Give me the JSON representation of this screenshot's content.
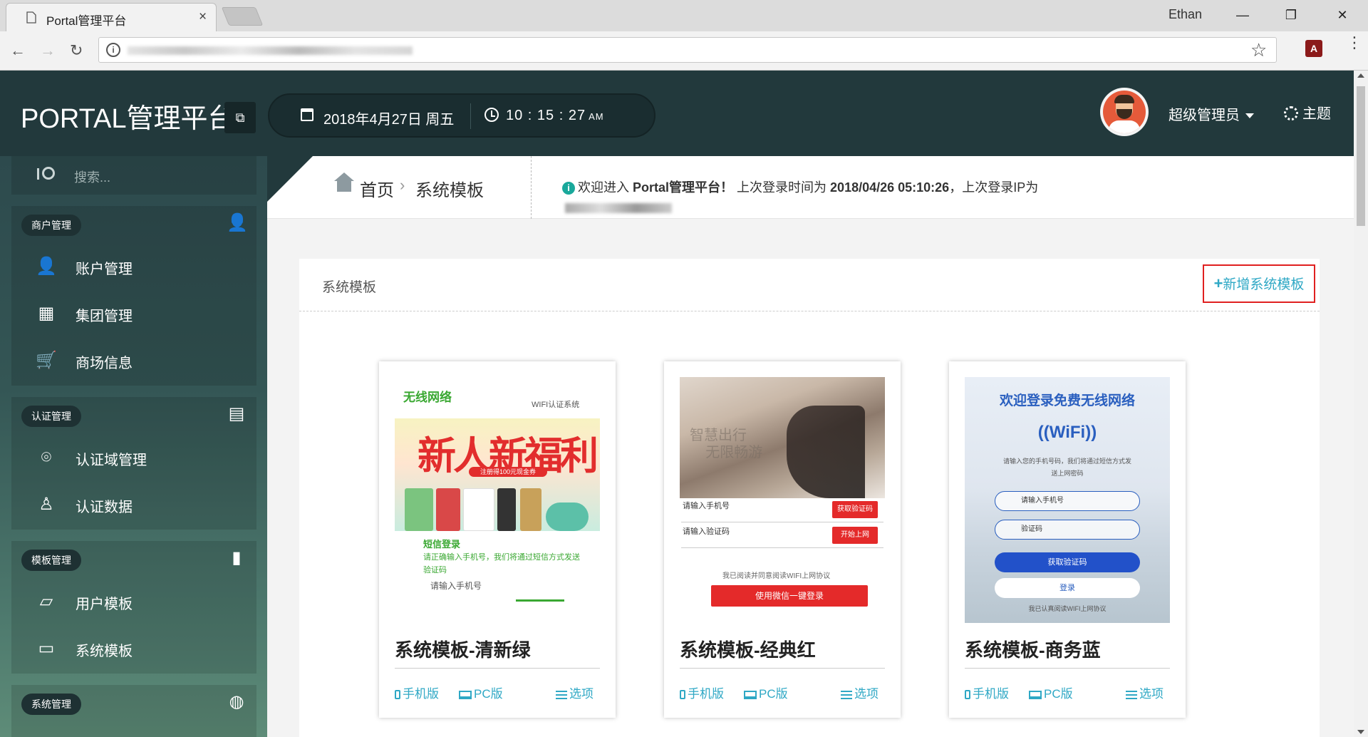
{
  "browser": {
    "tab_title": "Portal管理平台",
    "close_glyph": "×",
    "user": "Ethan",
    "minimize_glyph": "—",
    "restore_glyph": "❐",
    "win_close_glyph": "✕",
    "back_glyph": "←",
    "forward_glyph": "→",
    "reload_glyph": "↻",
    "star_glyph": "☆",
    "info_glyph": "i",
    "pdf_glyph": "A",
    "menu_glyph": "⋮"
  },
  "header": {
    "brand": "PORTAL管理平台",
    "toggle_glyph": "⧉",
    "date": "2018年4月27日 周五",
    "time": "10 : 15 : 27",
    "ampm": "AM",
    "user_name": "超级管理员",
    "theme_label": "主题"
  },
  "sidebar": {
    "search_placeholder": "搜索...",
    "groups": [
      {
        "label": "商户管理",
        "icon": "add-user-icon",
        "icon_glyph": "👤",
        "items": [
          {
            "label": "账户管理",
            "icon": "user-icon",
            "icon_glyph": "👤"
          },
          {
            "label": "集团管理",
            "icon": "building-icon",
            "icon_glyph": "▦"
          },
          {
            "label": "商场信息",
            "icon": "cart-icon",
            "icon_glyph": "🛒"
          }
        ]
      },
      {
        "label": "认证管理",
        "icon": "document-icon",
        "icon_glyph": "▤",
        "items": [
          {
            "label": "认证域管理",
            "icon": "location-icon",
            "icon_glyph": "⌾"
          },
          {
            "label": "认证数据",
            "icon": "person-outline-icon",
            "icon_glyph": "♙"
          }
        ]
      },
      {
        "label": "模板管理",
        "icon": "book-icon",
        "icon_glyph": "▮",
        "items": [
          {
            "label": "用户模板",
            "icon": "cards-icon",
            "icon_glyph": "▱"
          },
          {
            "label": "系统模板",
            "icon": "monitor-icon",
            "icon_glyph": "▭"
          }
        ]
      },
      {
        "label": "系统管理",
        "icon": "globe-icon",
        "icon_glyph": "◍",
        "items": []
      }
    ]
  },
  "breadcrumb": {
    "home": "首页",
    "sep": "›",
    "current": "系统模板"
  },
  "welcome": {
    "icon_glyph": "i",
    "prefix": "欢迎进入 ",
    "platform": "Portal管理平台！",
    "last_login_label": " 上次登录时间为 ",
    "last_login_time": "2018/04/26 05:10:26",
    "last_ip_label": "，上次登录IP为"
  },
  "panel": {
    "title": "系统模板",
    "add_plus": "+",
    "add_label": "新增系统模板"
  },
  "cards": [
    {
      "title": "系统模板-清新绿",
      "links": {
        "mobile": "手机版",
        "pc": "PC版",
        "options": "选项"
      },
      "preview": {
        "logo": "无线网络",
        "wifi_tag": "WIFI认证系统",
        "banner": "新人新福利",
        "strip": "注册得100元现金券",
        "sms_title": "短信登录",
        "sms_desc": "请正确输入手机号，我们将通过短信方式发送验证码",
        "phone_placeholder": "请输入手机号"
      }
    },
    {
      "title": "系统模板-经典红",
      "links": {
        "mobile": "手机版",
        "pc": "PC版",
        "options": "选项"
      },
      "preview": {
        "watermark_1": "智慧出行",
        "watermark_2": "无限畅游",
        "phone_label": "请输入手机号",
        "get_code": "获取验证码",
        "code_label": "请输入验证码",
        "start": "开始上网",
        "agree": "我已阅读并同意阅读WIFI上网协议",
        "wechat": "使用微信一键登录"
      }
    },
    {
      "title": "系统模板-商务蓝",
      "links": {
        "mobile": "手机版",
        "pc": "PC版",
        "options": "选项"
      },
      "preview": {
        "title": "欢迎登录免费无线网络",
        "wifi": "((WiFi))",
        "desc_1": "请输入您的手机号码，我们将通过短信方式发",
        "desc_2": "送上网密码",
        "phone_label": "请输入手机号",
        "code_label": "验证码",
        "get_code": "获取验证码",
        "login": "登录",
        "agree": "我已认真阅读WIFI上网协议"
      }
    }
  ],
  "colors": {
    "header_bg": "#22393c",
    "accent_link": "#2fa8c5",
    "highlight_border": "#e02020"
  }
}
